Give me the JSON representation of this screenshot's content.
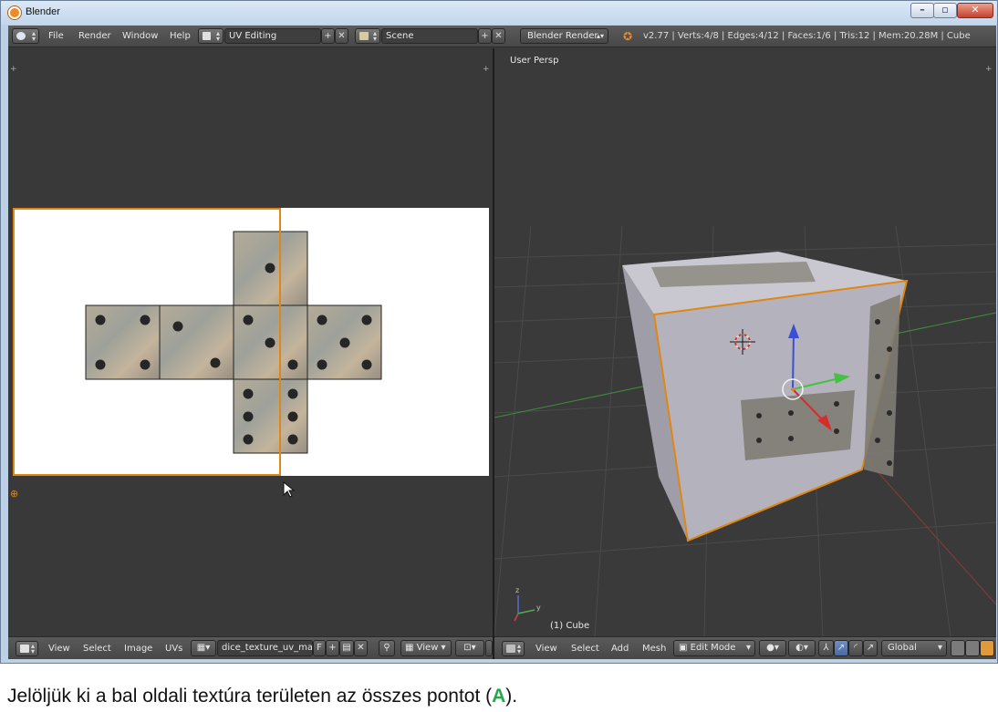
{
  "window": {
    "title": "Blender",
    "controls": {
      "minimize": "–",
      "maximize": "▫",
      "close": "✕"
    }
  },
  "info_header": {
    "menus": [
      "File",
      "Render",
      "Window",
      "Help"
    ],
    "screen_layout": "UV Editing",
    "scene": "Scene",
    "render_engine": "Blender Render",
    "stats": "v2.77 | Verts:4/8 | Edges:4/12 | Faces:1/6 | Tris:12 | Mem:20.28M | Cube"
  },
  "uv_editor": {
    "footer_menus": [
      "View",
      "Select",
      "Image",
      "UVs"
    ],
    "image_name": "dice_texture_uv_ma...",
    "fake_user": "F",
    "view_dropdown": "View",
    "icons": [
      "editor-type-icon",
      "image-browse-icon",
      "new-image-icon",
      "open-image-icon",
      "unlink-icon",
      "pin-icon",
      "view-mode-icon",
      "pivot-icon",
      "snap-icon"
    ]
  },
  "viewport_3d": {
    "view_label": "User Persp",
    "object_label": "(1) Cube",
    "footer_menus": [
      "View",
      "Select",
      "Add",
      "Mesh"
    ],
    "mode": "Edit Mode",
    "orientation": "Global",
    "axis_labels": {
      "x": "x",
      "y": "y",
      "z": "z"
    }
  },
  "colors": {
    "selection_orange": "#e08612",
    "blender_background": "#393939",
    "caption_key_green": "#27a74a"
  },
  "caption": {
    "text_before": "Jelöljük ki a bal oldali textúra területen az összes pontot (",
    "key": "A",
    "text_after": ")."
  }
}
